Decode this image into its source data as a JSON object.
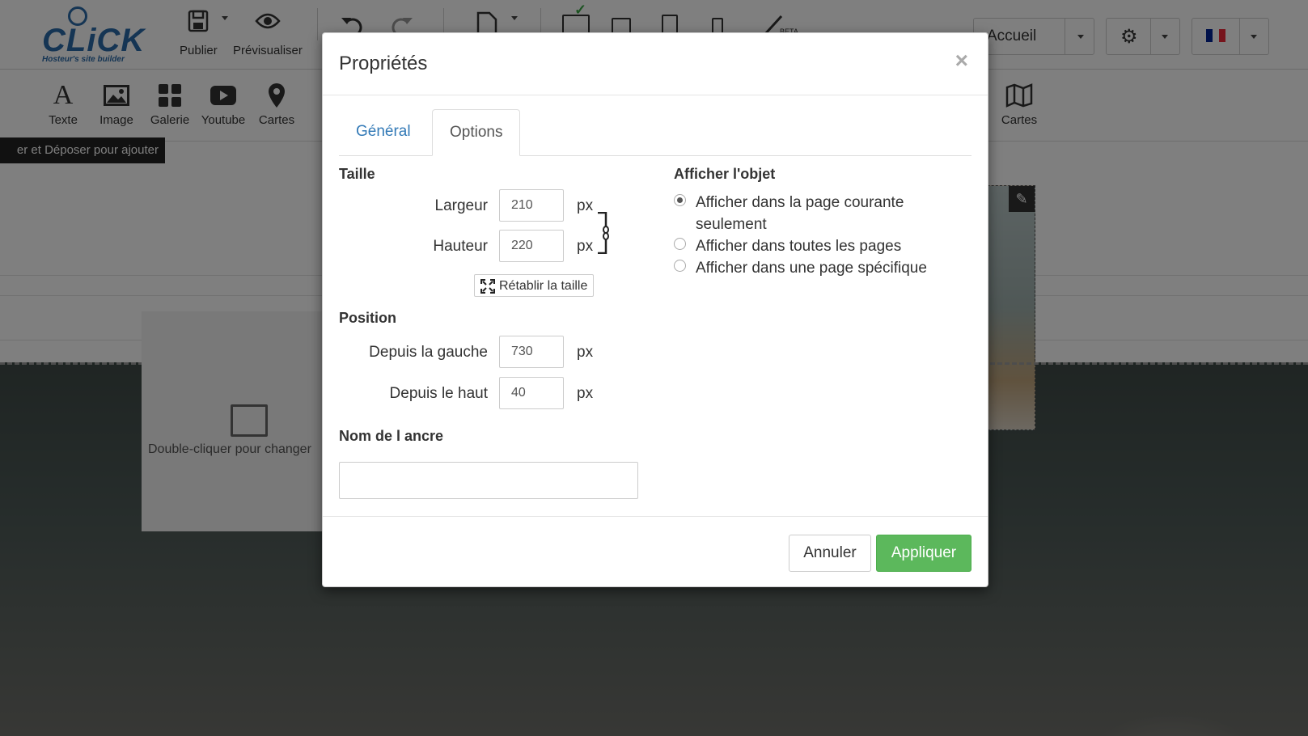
{
  "topbar": {
    "logo_text": "CLiCK",
    "logo_sub": "Hosteur's site builder",
    "publish_label": "Publier",
    "preview_label": "Prévisualiser",
    "page_select": "Accueil"
  },
  "widgets": [
    {
      "label": "Texte",
      "icon": "text-icon"
    },
    {
      "label": "Image",
      "icon": "image-icon"
    },
    {
      "label": "Galerie",
      "icon": "gallery-icon"
    },
    {
      "label": "Youtube",
      "icon": "youtube-icon"
    },
    {
      "label": "Cartes",
      "icon": "map-pin-icon"
    },
    {
      "label": "Cartes",
      "icon": "map-icon"
    }
  ],
  "drag_tip": "er et Déposer pour ajouter",
  "placeholder_text": "Double-cliquer pour changer",
  "modal": {
    "title": "Propriétés",
    "close": "×",
    "tabs": [
      "Général",
      "Options"
    ],
    "size": {
      "title": "Taille",
      "width_label": "Largeur",
      "width_value": "210",
      "height_label": "Hauteur",
      "height_value": "220",
      "unit": "px",
      "reset_label": "Rétablir la taille"
    },
    "position": {
      "title": "Position",
      "left_label": "Depuis la gauche",
      "left_value": "730",
      "top_label": "Depuis le haut",
      "top_value": "40",
      "unit": "px"
    },
    "anchor": {
      "title": "Nom de l ancre",
      "value": ""
    },
    "display": {
      "title": "Afficher l'objet",
      "options": [
        {
          "line1": "Afficher dans la page courante",
          "line2": "seulement",
          "selected": true
        },
        {
          "line1": "Afficher dans toutes les pages",
          "selected": false
        },
        {
          "line1": "Afficher dans une page spécifique",
          "selected": false
        }
      ]
    },
    "cancel_label": "Annuler",
    "apply_label": "Appliquer"
  },
  "colors": {
    "primary_link": "#337ab7",
    "apply_green": "#5cb85c",
    "logo_blue": "#2b6aa8"
  }
}
